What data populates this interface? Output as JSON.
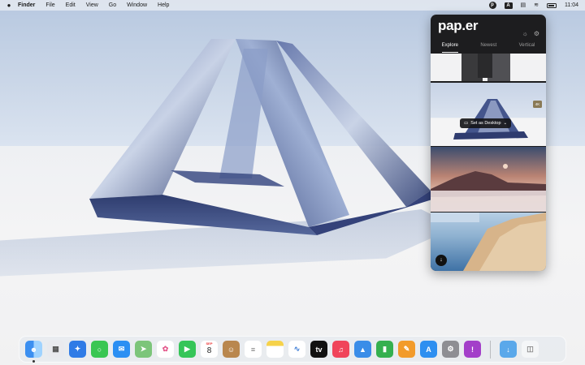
{
  "menubar": {
    "apple": "",
    "app_name": "Finder",
    "menus": [
      "File",
      "Edit",
      "View",
      "Go",
      "Window",
      "Help"
    ],
    "status": {
      "paper_icon": "paper-menubar-icon",
      "input_source": "A",
      "clock": "11:04"
    }
  },
  "panel": {
    "logo": "pap.er",
    "tabs": [
      "Explore",
      "Newest",
      "Vertical"
    ],
    "active_tab": "Explore",
    "set_desktop_label": "Set as Desktop",
    "badge": "4K",
    "thumbnails": [
      "fashion-photo",
      "glass-pyramid",
      "mountain-sunrise-clouds",
      "coastal-town"
    ]
  },
  "dock": {
    "calendar_month": "SEP",
    "calendar_day": "8",
    "apps": [
      "Finder",
      "Launchpad",
      "Safari",
      "Messages",
      "Mail",
      "Maps",
      "Photos",
      "FaceTime",
      "Calendar",
      "Contacts",
      "Reminders",
      "Notes",
      "Freeform",
      "TV",
      "Music",
      "Keynote",
      "Numbers",
      "Pages",
      "App Store",
      "System Settings",
      "Feedback Assistant",
      "Downloads",
      "Trash"
    ]
  },
  "colors": {
    "panel_bg": "#1d1d1f",
    "pyramid": "#3c4f86"
  }
}
